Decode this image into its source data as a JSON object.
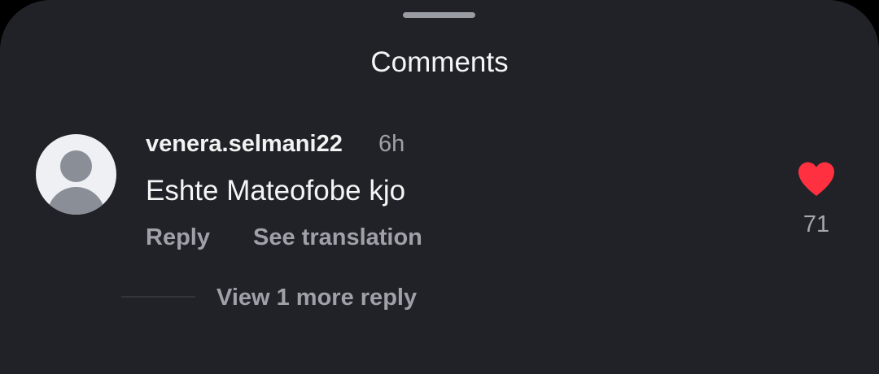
{
  "sheet": {
    "title": "Comments"
  },
  "comment": {
    "username": "venera.selmani22",
    "time": "6h",
    "text": "Eshte Mateofobe kjo",
    "reply_label": "Reply",
    "translate_label": "See translation",
    "like_count": "71",
    "liked": true,
    "heart_color": "#ff3040",
    "avatar_icon": "default-avatar-icon",
    "heart_icon": "heart-filled-icon"
  },
  "replies": {
    "view_more_label": "View 1 more reply"
  }
}
